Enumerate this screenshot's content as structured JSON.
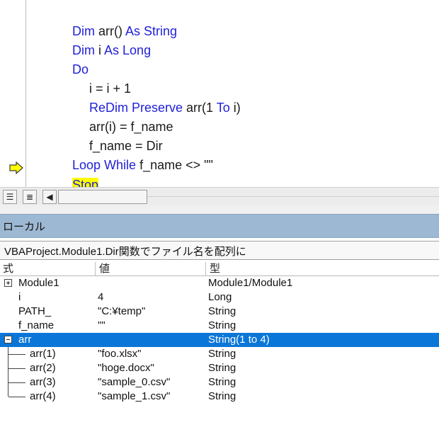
{
  "code": {
    "lines": [
      {
        "parts": [
          {
            "t": "Dim ",
            "k": true
          },
          {
            "t": "arr() ",
            "k": false
          },
          {
            "t": "As String",
            "k": true
          }
        ]
      },
      {
        "parts": [
          {
            "t": "Dim ",
            "k": true
          },
          {
            "t": "i ",
            "k": false
          },
          {
            "t": "As Long",
            "k": true
          }
        ]
      },
      {
        "parts": [
          {
            "t": "Do",
            "k": true
          }
        ]
      },
      {
        "parts": [
          {
            "t": "i = i + 1",
            "k": false
          }
        ]
      },
      {
        "parts": [
          {
            "t": "ReDim Preserve ",
            "k": true
          },
          {
            "t": "arr(1 ",
            "k": false
          },
          {
            "t": "To ",
            "k": true
          },
          {
            "t": "i)",
            "k": false
          }
        ]
      },
      {
        "parts": [
          {
            "t": "arr(i) = f_name",
            "k": false
          }
        ]
      },
      {
        "parts": [
          {
            "t": "f_name = Dir",
            "k": false
          }
        ]
      },
      {
        "parts": [
          {
            "t": "Loop While ",
            "k": true
          },
          {
            "t": "f_name <> \"\"",
            "k": false
          }
        ]
      },
      {
        "parts": [
          {
            "t": "Stop",
            "k": true
          }
        ]
      }
    ],
    "current_line_text": "Stop",
    "current_line_icon": "execution-arrow-icon"
  },
  "editor_strip": {
    "procedure_view_icon": "procedure-view-icon",
    "full_module_view_icon": "full-module-view-icon",
    "scroll_left_icon": "scroll-left-icon",
    "procedure_view_glyph": "☰",
    "full_module_view_glyph": "≣",
    "scroll_left_glyph": "◀"
  },
  "locals": {
    "title": "ローカル",
    "context": "VBAProject.Module1.Dir関数でファイル名を配列に",
    "columns": {
      "expression": "式",
      "value": "値",
      "type": "型"
    },
    "rows": [
      {
        "name": "Module1",
        "value": "",
        "type": "Module1/Module1"
      },
      {
        "name": "i",
        "value": "4",
        "type": "Long"
      },
      {
        "name": "PATH_",
        "value": "\"C:¥temp\"",
        "type": "String"
      },
      {
        "name": "f_name",
        "value": "\"\"",
        "type": "String"
      },
      {
        "name": "arr",
        "value": "",
        "type": "String(1 to 4)"
      },
      {
        "name": "arr(1)",
        "value": "\"foo.xlsx\"",
        "type": "String"
      },
      {
        "name": "arr(2)",
        "value": "\"hoge.docx\"",
        "type": "String"
      },
      {
        "name": "arr(3)",
        "value": "\"sample_0.csv\"",
        "type": "String"
      },
      {
        "name": "arr(4)",
        "value": "\"sample_1.csv\"",
        "type": "String"
      }
    ],
    "expand_icon": "expand-plus-icon",
    "collapse_icon": "collapse-minus-icon"
  },
  "colors": {
    "keyword": "#1f1fd8",
    "highlight": "#ffff00",
    "selection": "#0a76d8",
    "title_bar": "#9db8d2"
  }
}
